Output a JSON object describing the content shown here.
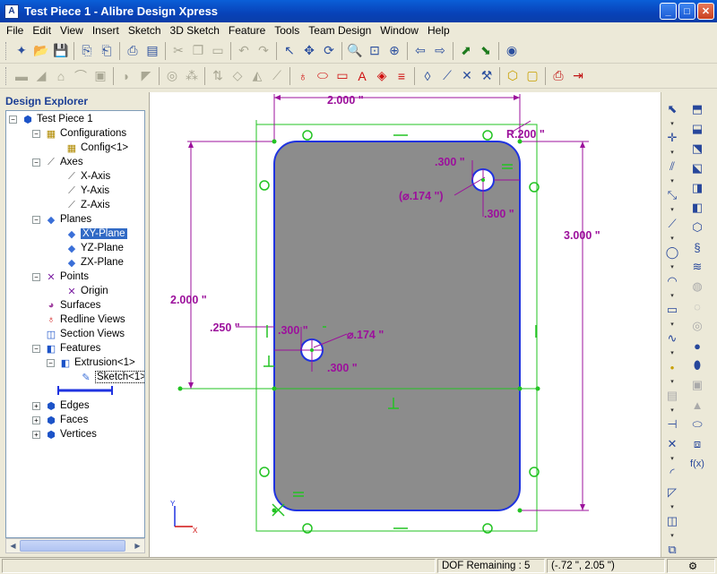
{
  "window": {
    "title": "Test Piece 1 - Alibre Design Xpress"
  },
  "menu": [
    "File",
    "Edit",
    "View",
    "Insert",
    "Sketch",
    "3D Sketch",
    "Feature",
    "Tools",
    "Team Design",
    "Window",
    "Help"
  ],
  "explorer": {
    "header": "Design Explorer",
    "nodes": [
      "Test Piece 1",
      "Configurations",
      "Config<1>",
      "Axes",
      "X-Axis",
      "Y-Axis",
      "Z-Axis",
      "Planes",
      "XY-Plane",
      "YZ-Plane",
      "ZX-Plane",
      "Points",
      "Origin",
      "Surfaces",
      "Redline Views",
      "Section Views",
      "Features",
      "Extrusion<1>",
      "Sketch<1>",
      "Edges",
      "Faces",
      "Vertices"
    ]
  },
  "sketch": {
    "dims": {
      "width_top": "2.000 \"",
      "height_right": "3.000 \"",
      "corner_radius": "R.200 \"",
      "hole_top_x": ".300 \"",
      "hole_top_dia": "(⌀.174 \")",
      "hole_top_y": ".300 \"",
      "hole_bottom_height": "2.000 \"",
      "hole_bottom_offset": ".250 \"",
      "hole_bottom_x": ".300 \"",
      "hole_bottom_dia": "⌀.174 \"",
      "hole_bottom_y": ".300 \""
    },
    "colors": {
      "part_fill": "#8c8c8c",
      "outline": "#1f33e0",
      "dimension": "#9c109c",
      "constraint": "#22c322"
    }
  },
  "status": {
    "dof": "DOF Remaining : 5",
    "coords": "(-.72 \", 2.05 \")"
  }
}
